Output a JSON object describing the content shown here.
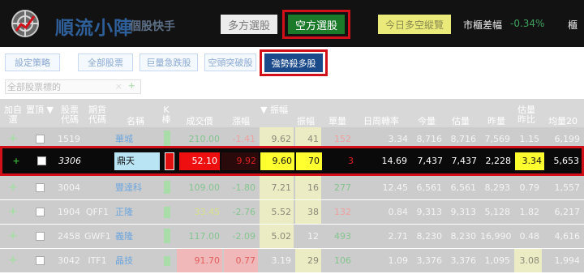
{
  "header": {
    "app_title": "順流小陣",
    "app_subtitle": "個股快手",
    "long_button": "多方選股",
    "short_button": "空方選股",
    "outlook_button": "今日多空縱覽",
    "market_label": "市櫃差幅",
    "market_value": "-0.34%",
    "sector_label": "櫃"
  },
  "toolbar": {
    "tabs": [
      "設定策略",
      "全部股票",
      "巨量急跌股",
      "空頭突破股",
      "強勢殺多股"
    ],
    "active_tab": "強勢殺多股"
  },
  "filter": {
    "label": "全部股票標的",
    "clear": "×",
    "add": "+"
  },
  "table": {
    "headers": [
      "加自選",
      "置頂 ▼",
      "股票代碼",
      "期貨代碼",
      "名稱",
      "K棒",
      "成交價",
      "漲幅",
      "▼ 振幅",
      "振幅",
      "單量",
      "日周轉率",
      "今量",
      "估量",
      "昨量",
      "估量昨比",
      "均量20"
    ],
    "rows": [
      {
        "code": "1519",
        "fut": "",
        "name": "華城",
        "price": "210.00",
        "chg": "-1.41",
        "amp": "9.62",
        "amp2": "41",
        "single": "152",
        "turnover": "3.34",
        "today": "8,716",
        "est": "8,716",
        "yday": "7,569",
        "ratio": "1.15",
        "avg": "6,199"
      },
      {
        "code": "3306",
        "fut": "",
        "name": "鼎天",
        "price": "52.10",
        "chg": "9.92",
        "amp": "9.60",
        "amp2": "70",
        "single": "3",
        "turnover": "14.69",
        "today": "7,437",
        "est": "7,437",
        "yday": "2,228",
        "ratio": "3.34",
        "avg": "5,653"
      },
      {
        "code": "3004",
        "fut": "",
        "name": "豐達科",
        "price": "109.00",
        "chg": "-1.80",
        "amp": "7.21",
        "amp2": "16",
        "single": "277",
        "turnover": "12.45",
        "today": "6,561",
        "est": "6,561",
        "yday": "8,293",
        "ratio": "0.79",
        "avg": "1,557"
      },
      {
        "code": "1904",
        "fut": "QFF1",
        "name": "正隆",
        "price": "33.45",
        "chg": "-2.76",
        "amp": "5.52",
        "amp2": "38",
        "single": "132",
        "turnover": "0.84",
        "today": "9,313",
        "est": "9,313",
        "yday": "5,128",
        "ratio": "1.82",
        "avg": "6,217"
      },
      {
        "code": "2458",
        "fut": "GWF1",
        "name": "義隆",
        "price": "117.00",
        "chg": "-2.09",
        "amp": "5.02",
        "amp2": "12",
        "single": "493",
        "turnover": "2.71",
        "today": "8,230",
        "est": "8,230",
        "yday": "16,990",
        "ratio": "0.48",
        "avg": "4,616"
      },
      {
        "code": "3042",
        "fut": "ITF1",
        "name": "晶技",
        "price": "91.70",
        "chg": "0.77",
        "amp": "3.19",
        "amp2": "29",
        "single": "106",
        "turnover": "1.09",
        "today": "3,376",
        "est": "3,376",
        "yday": "1,095",
        "ratio": "3.08",
        "avg": "1,994"
      }
    ]
  },
  "colors": {
    "accent_red": "#d2101a",
    "short_green": "#1a7a2a",
    "active_tab": "#1a4a8a"
  }
}
